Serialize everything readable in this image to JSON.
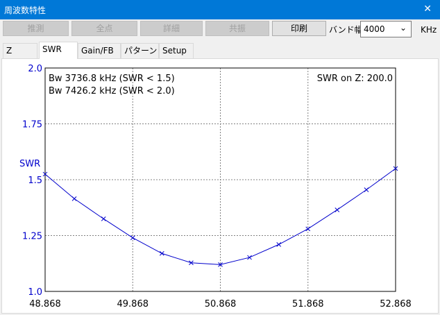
{
  "window": {
    "title": "周波数特性",
    "close_icon": "close-icon"
  },
  "toolbar": {
    "buttons": [
      {
        "label": "推測",
        "enabled": false
      },
      {
        "label": "全点",
        "enabled": false
      },
      {
        "label": "詳細",
        "enabled": false
      },
      {
        "label": "共振",
        "enabled": false
      },
      {
        "label": "印刷",
        "enabled": true
      }
    ],
    "band_label": "バンド幅",
    "band_value": "4000",
    "unit": "KHz"
  },
  "tabs": [
    {
      "label": "Z",
      "active": false
    },
    {
      "label": "SWR",
      "active": true
    },
    {
      "label": "Gain/FB",
      "active": false
    },
    {
      "label": "パターン",
      "active": false
    },
    {
      "label": "Setup",
      "active": false
    }
  ],
  "chart_data": {
    "type": "line",
    "ylabel": "SWR",
    "xlim": [
      48.868,
      52.868
    ],
    "ylim": [
      1.0,
      2.0
    ],
    "x_ticks": [
      "48.868",
      "49.868",
      "50.868",
      "51.868",
      "52.868"
    ],
    "y_ticks": [
      "1.0",
      "1.25",
      "1.5",
      "1.75",
      "2.0"
    ],
    "grid": true,
    "annotations": [
      "Bw 3736.8 kHz (SWR < 1.5)",
      "Bw 7426.2 kHz (SWR < 2.0)",
      "SWR on Z: 200.0"
    ],
    "series": [
      {
        "color": "#0000cc",
        "x": [
          48.868,
          49.201,
          49.535,
          49.868,
          50.201,
          50.535,
          50.868,
          51.201,
          51.535,
          51.868,
          52.201,
          52.535,
          52.868
        ],
        "y": [
          1.525,
          1.415,
          1.325,
          1.24,
          1.17,
          1.128,
          1.12,
          1.152,
          1.21,
          1.28,
          1.365,
          1.455,
          1.55
        ]
      }
    ],
    "axis_color": "#0000cc",
    "grid_color": "#808080"
  }
}
